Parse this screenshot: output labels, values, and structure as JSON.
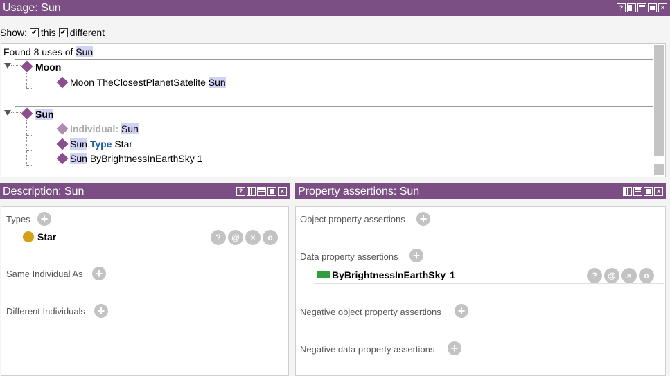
{
  "usage": {
    "title": "Usage: Sun",
    "show_label": "Show:",
    "this_label": "this",
    "different_label": "different",
    "found_prefix": "Found 8 uses of",
    "found_entity": "Sun",
    "groups": [
      {
        "name": "Moon",
        "items": [
          {
            "parts": [
              "Moon",
              "TheClosestPlanetSatelite",
              "Sun"
            ]
          }
        ]
      },
      {
        "name": "Sun",
        "items": [
          {
            "keyword": "Individual:",
            "subject": "Sun"
          },
          {
            "subject": "Sun",
            "keyword": "Type",
            "object": "Star"
          },
          {
            "subject": "Sun",
            "predicate": "ByBrightnessInEarthSky",
            "value": "1"
          }
        ]
      }
    ],
    "icons": [
      "help-icon",
      "split-vertical-icon",
      "split-horizontal-icon",
      "maximize-icon",
      "close-icon"
    ]
  },
  "description": {
    "title": "Description: Sun",
    "types_label": "Types",
    "type_value": "Star",
    "same_label": "Same Individual As",
    "different_label": "Different Individuals",
    "type_dot_color": "#d4a017"
  },
  "property": {
    "title": "Property assertions: Sun",
    "object_label": "Object property assertions",
    "data_label": "Data property assertions",
    "data_prop_name": "ByBrightnessInEarthSky",
    "data_prop_value": "1",
    "neg_object_label": "Negative object property assertions",
    "neg_data_label": "Negative data property assertions",
    "data_prop_color": "#2e9e3e"
  },
  "colors": {
    "titlebar": "#7b4f84",
    "highlight": "#d2d2f4",
    "entity_diamond": "#8c4f8e",
    "keyword": "#1f5fa8"
  }
}
